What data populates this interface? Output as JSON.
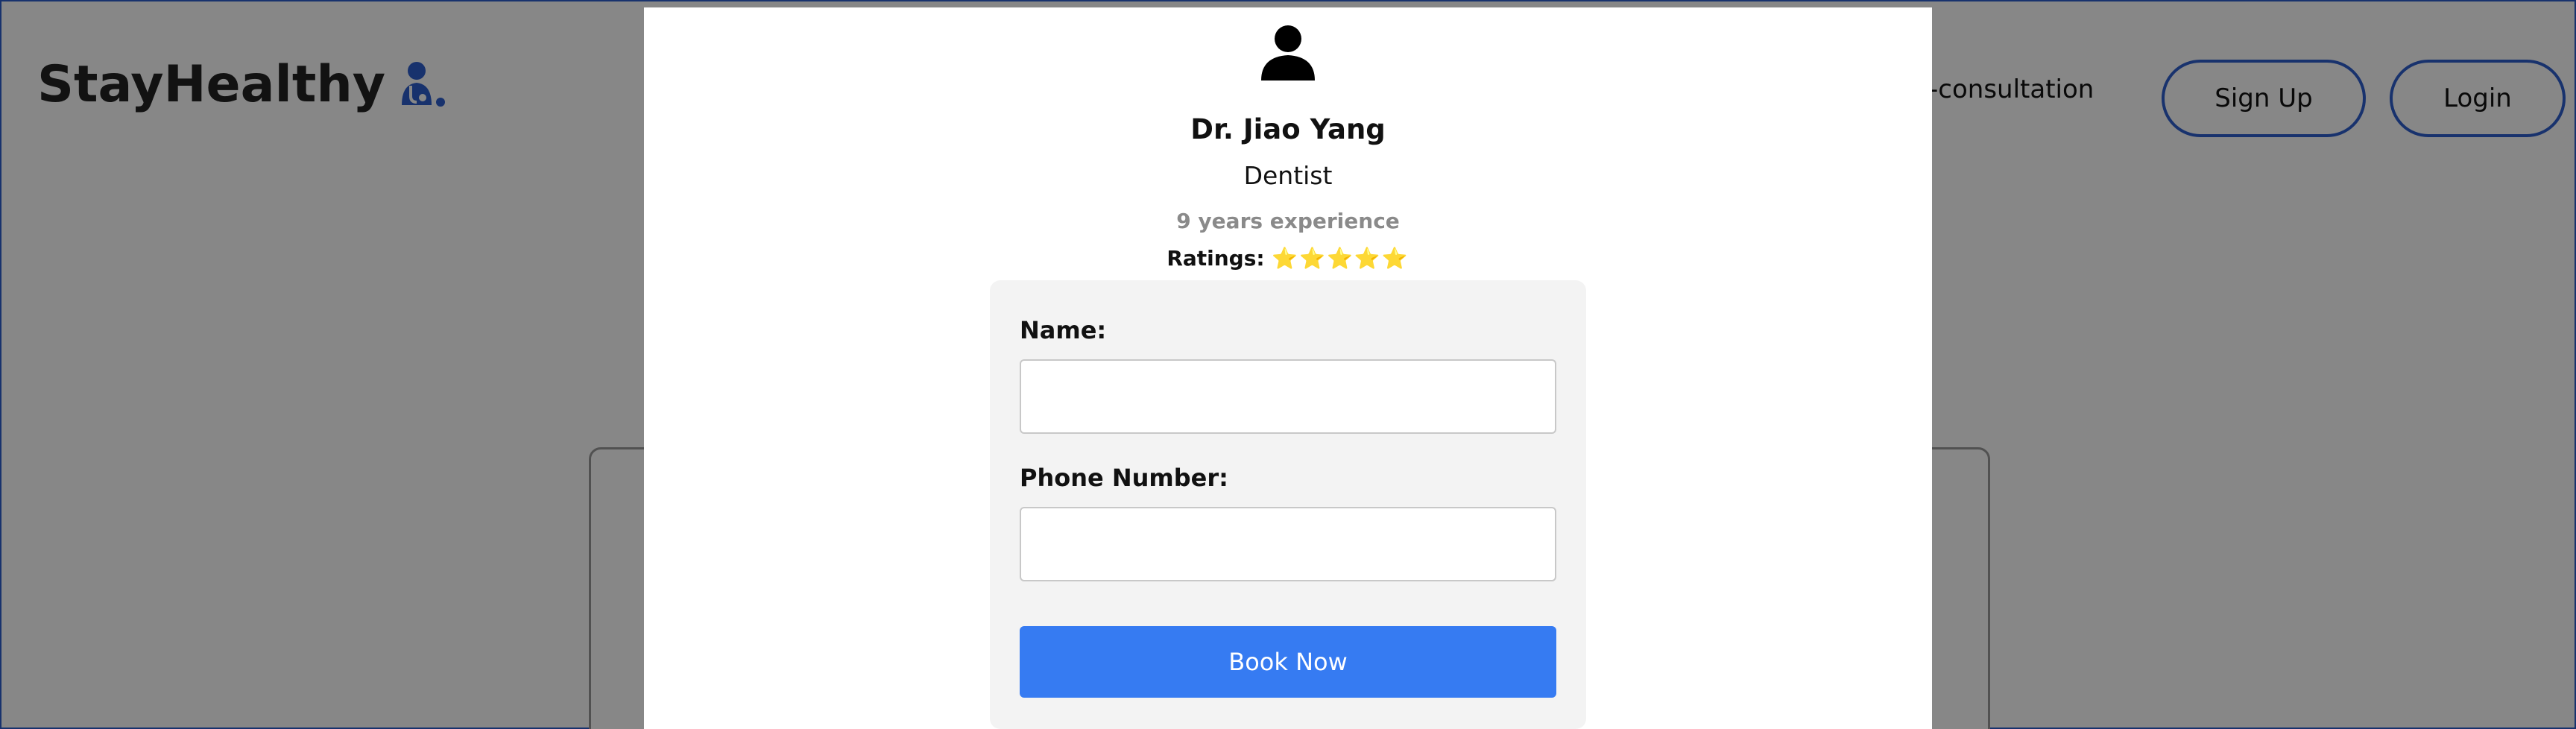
{
  "header": {
    "logo_text": "StayHealthy",
    "logo_icon": "doctor-icon",
    "nav_partial": "-consultation",
    "signup_label": "Sign Up",
    "login_label": "Login"
  },
  "modal": {
    "avatar_icon": "user-icon",
    "doctor_name": "Dr. Jiao Yang",
    "speciality": "Dentist",
    "experience": "9 years experience",
    "ratings_label": "Ratings:",
    "ratings_stars": "⭐⭐⭐⭐⭐",
    "form": {
      "name_label": "Name:",
      "name_value": "",
      "phone_label": "Phone Number:",
      "phone_value": "",
      "submit_label": "Book Now"
    }
  },
  "colors": {
    "accent": "#2f5fcf",
    "button": "#367bf2",
    "overlay": "rgba(0,0,0,0.47)"
  }
}
